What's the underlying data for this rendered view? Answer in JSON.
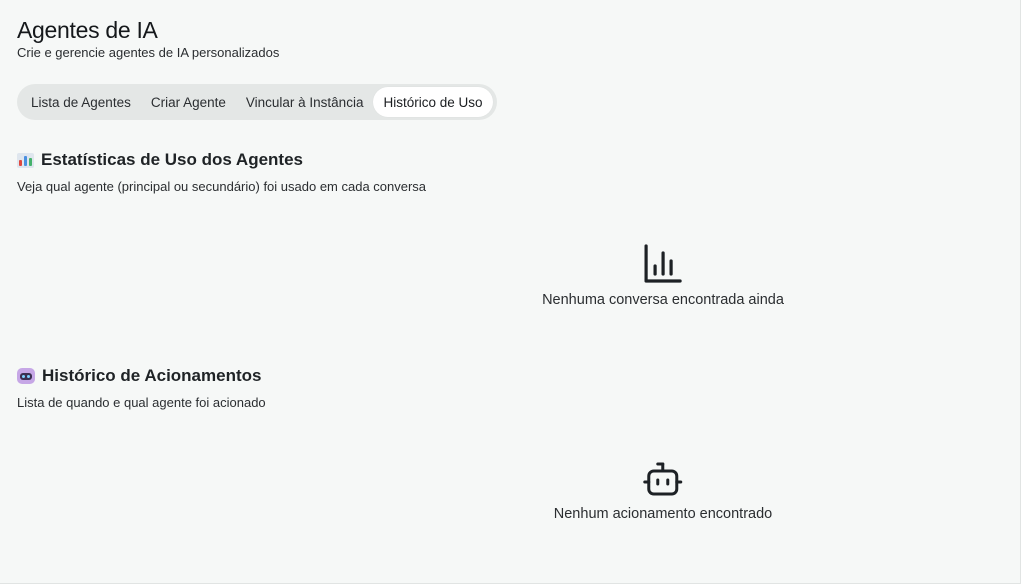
{
  "header": {
    "title": "Agentes de IA",
    "subtitle": "Crie e gerencie agentes de IA personalizados"
  },
  "tabs": [
    {
      "label": "Lista de Agentes",
      "active": false
    },
    {
      "label": "Criar Agente",
      "active": false
    },
    {
      "label": "Vincular à Instância",
      "active": false
    },
    {
      "label": "Histórico de Uso",
      "active": true
    }
  ],
  "stats_section": {
    "icon": "bar-chart-emoji",
    "title": "Estatísticas de Uso dos Agentes",
    "description": "Veja qual agente (principal ou secundário) foi usado em cada conversa",
    "empty_icon": "bar-chart-icon",
    "empty_text": "Nenhuma conversa encontrada ainda"
  },
  "history_section": {
    "icon": "robot-emoji",
    "title": "Histórico de Acionamentos",
    "description": "Lista de quando e qual agente foi acionado",
    "empty_icon": "bot-icon",
    "empty_text": "Nenhum acionamento encontrado"
  },
  "colors": {
    "background": "#f6f8f7",
    "tab_track": "#e4e7e6",
    "tab_active": "#ffffff",
    "text": "#1c1f22"
  }
}
